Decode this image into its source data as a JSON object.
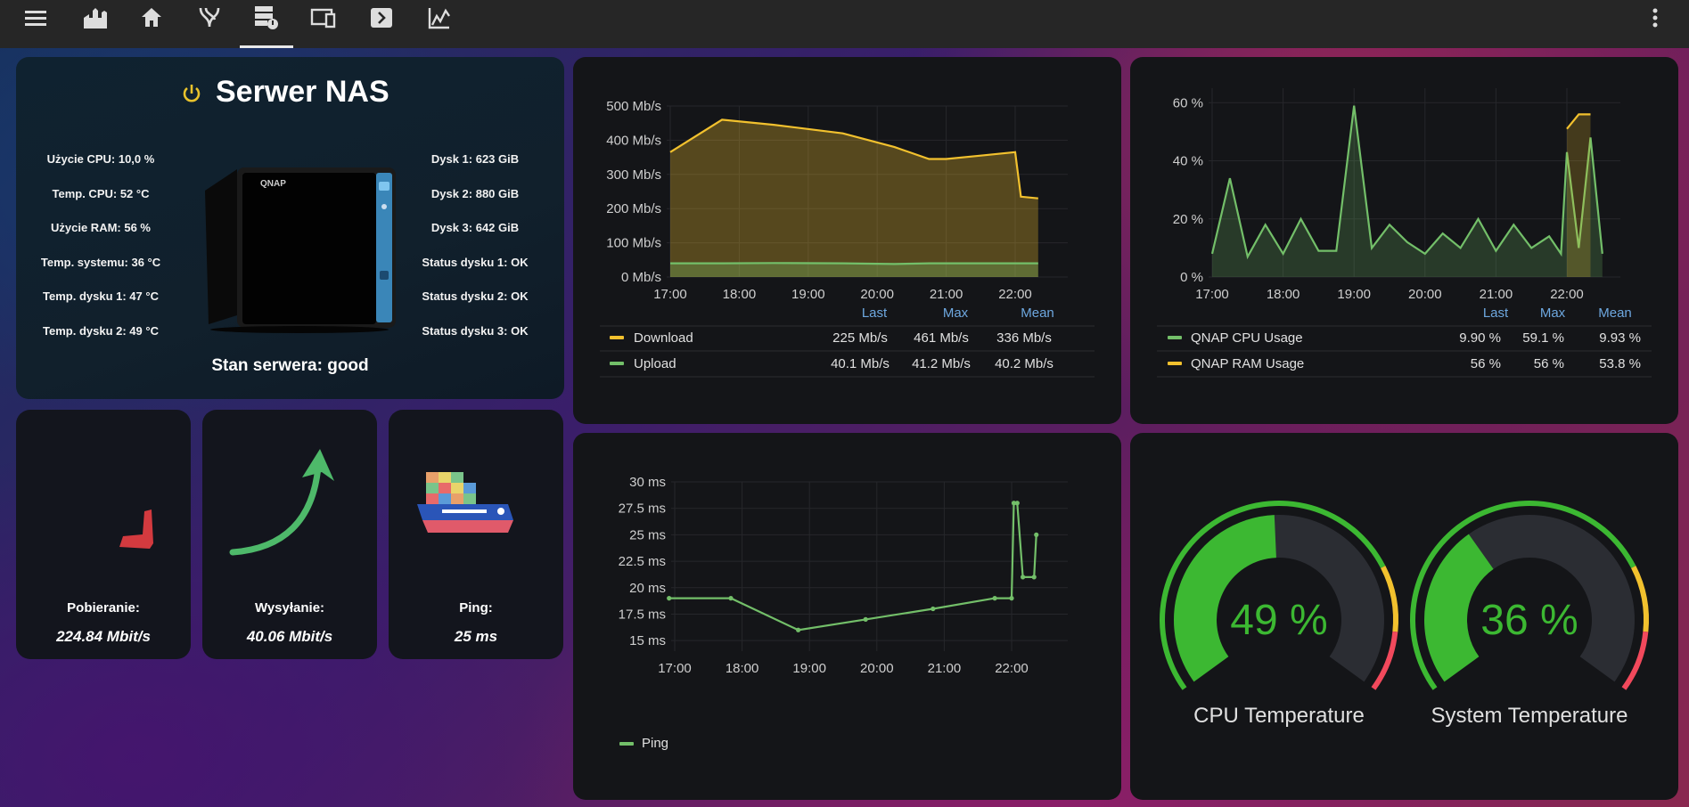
{
  "topbar": {
    "icons": [
      "menu-icon",
      "castle-icon",
      "home-icon",
      "branches-icon",
      "server-icon",
      "devices-icon",
      "terminal-icon",
      "chart-icon"
    ],
    "more_icon": "dots-vertical-icon"
  },
  "nas": {
    "title": "Serwer NAS",
    "power_icon": "power-icon",
    "left_stats": [
      "Użycie CPU: 10,0 %",
      "Temp. CPU: 52 °C",
      "Użycie RAM: 56 %",
      "Temp. systemu: 36 °C",
      "Temp. dysku 1: 47 °C",
      "Temp. dysku 2: 49 °C"
    ],
    "right_stats": [
      "Dysk 1: 623 GiB",
      "Dysk 2: 880 GiB",
      "Dysk 3: 642 GiB",
      "Status dysku 1: OK",
      "Status dysku 2: OK",
      "Status dysku 3: OK"
    ],
    "device_brand": "QNAP",
    "status": "Stan serwera: good"
  },
  "speed": {
    "download": {
      "label": "Pobieranie:",
      "value": "224.84 Mbit/s"
    },
    "upload": {
      "label": "Wysyłanie:",
      "value": "40.06 Mbit/s"
    },
    "ping": {
      "label": "Ping:",
      "value": "25 ms"
    }
  },
  "net_chart": {
    "legend_headers": [
      "Last",
      "Max",
      "Mean"
    ],
    "rows": [
      {
        "name": "Download",
        "color": "#f2c12e",
        "last": "225 Mb/s",
        "max": "461 Mb/s",
        "mean": "336 Mb/s"
      },
      {
        "name": "Upload",
        "color": "#73bf69",
        "last": "40.1 Mb/s",
        "max": "41.2 Mb/s",
        "mean": "40.2 Mb/s"
      }
    ]
  },
  "cpu_chart": {
    "legend_headers": [
      "Last",
      "Max",
      "Mean"
    ],
    "rows": [
      {
        "name": "QNAP CPU Usage",
        "color": "#73bf69",
        "last": "9.90 %",
        "max": "59.1 %",
        "mean": "9.93 %"
      },
      {
        "name": "QNAP RAM Usage",
        "color": "#f2c12e",
        "last": "56 %",
        "max": "56 %",
        "mean": "53.8 %"
      }
    ]
  },
  "ping_chart": {
    "legend": "Ping",
    "color": "#73bf69"
  },
  "gauges": [
    {
      "value": 49,
      "text": "49 %",
      "title": "CPU Temperature"
    },
    {
      "value": 36,
      "text": "36 %",
      "title": "System Temperature"
    }
  ],
  "chart_data": [
    {
      "type": "area",
      "x": [
        "17:00",
        "17:45",
        "18:30",
        "19:30",
        "20:15",
        "20:45",
        "21:00",
        "21:30",
        "22:00",
        "22:05",
        "22:20"
      ],
      "series": [
        {
          "name": "Download",
          "values": [
            365,
            460,
            445,
            420,
            380,
            345,
            345,
            355,
            365,
            235,
            230
          ]
        },
        {
          "name": "Upload",
          "values": [
            40,
            40,
            41,
            40,
            38,
            40,
            40,
            40,
            40,
            40,
            40
          ]
        }
      ],
      "xticks": [
        "17:00",
        "18:00",
        "19:00",
        "20:00",
        "21:00",
        "22:00"
      ],
      "yticks": [
        "0 Mb/s",
        "100 Mb/s",
        "200 Mb/s",
        "300 Mb/s",
        "400 Mb/s",
        "500 Mb/s"
      ],
      "ylim": [
        0,
        500
      ]
    },
    {
      "type": "line",
      "x": [
        "17:00",
        "17:15",
        "17:30",
        "17:45",
        "18:00",
        "18:15",
        "18:30",
        "18:45",
        "19:00",
        "19:15",
        "19:30",
        "19:45",
        "20:00",
        "20:15",
        "20:30",
        "20:45",
        "21:00",
        "21:15",
        "21:30",
        "21:45",
        "21:55",
        "22:00",
        "22:10",
        "22:20",
        "22:30"
      ],
      "series": [
        {
          "name": "QNAP CPU Usage",
          "values": [
            8,
            34,
            7,
            18,
            8,
            20,
            9,
            9,
            59,
            10,
            18,
            12,
            8,
            15,
            10,
            20,
            9,
            18,
            10,
            14,
            8,
            43,
            10,
            48,
            8
          ]
        },
        {
          "name": "QNAP RAM Usage",
          "values": [
            null,
            null,
            null,
            null,
            null,
            null,
            null,
            null,
            null,
            null,
            null,
            null,
            null,
            null,
            null,
            null,
            null,
            null,
            null,
            null,
            null,
            51,
            56,
            56,
            null
          ]
        }
      ],
      "xticks": [
        "17:00",
        "18:00",
        "19:00",
        "20:00",
        "21:00",
        "22:00"
      ],
      "yticks": [
        "0 %",
        "20 %",
        "40 %",
        "60 %"
      ],
      "ylim": [
        0,
        65
      ]
    },
    {
      "type": "line",
      "x": [
        "16:55",
        "17:50",
        "18:50",
        "19:50",
        "20:50",
        "21:45",
        "22:00",
        "22:02",
        "22:05",
        "22:10",
        "22:20",
        "22:22"
      ],
      "series": [
        {
          "name": "Ping",
          "values": [
            19,
            19,
            16,
            17,
            18,
            19,
            19,
            28,
            28,
            21,
            21,
            25
          ]
        }
      ],
      "xticks": [
        "17:00",
        "18:00",
        "19:00",
        "20:00",
        "21:00",
        "22:00"
      ],
      "yticks": [
        "15 ms",
        "17.5 ms",
        "20 ms",
        "22.5 ms",
        "25 ms",
        "27.5 ms",
        "30 ms"
      ],
      "ylim": [
        14,
        30
      ]
    }
  ]
}
